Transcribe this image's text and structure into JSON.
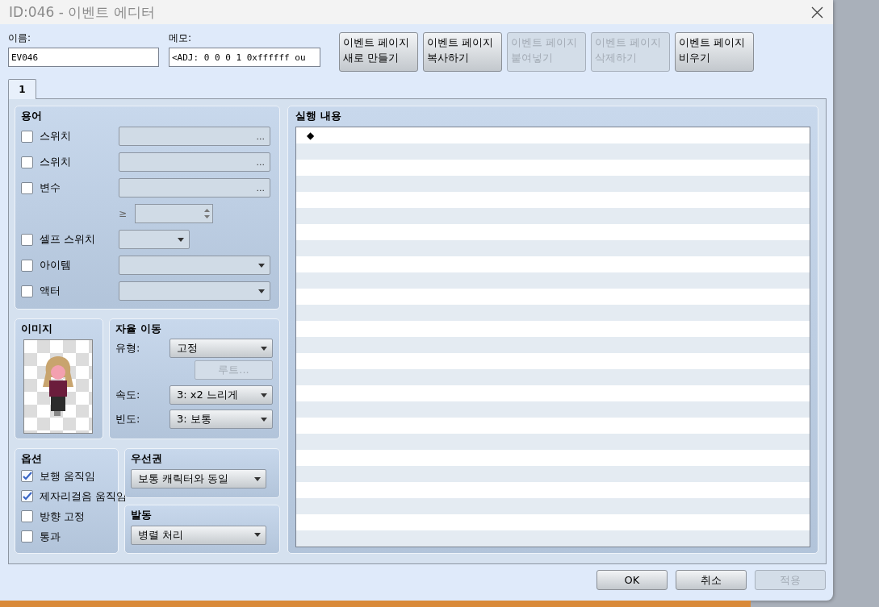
{
  "window": {
    "title": "ID:046 - 이벤트 에디터"
  },
  "name_field": {
    "label": "이름:",
    "value": "EV046"
  },
  "memo_field": {
    "label": "메모:",
    "value": "<ADJ: 0 0 0 1 0xffffff ou"
  },
  "page_buttons": [
    {
      "lines": [
        "이벤트 페이지",
        "새로 만들기"
      ],
      "disabled": false
    },
    {
      "lines": [
        "이벤트 페이지",
        "복사하기"
      ],
      "disabled": false
    },
    {
      "lines": [
        "이벤트 페이지",
        "붙여넣기"
      ],
      "disabled": true
    },
    {
      "lines": [
        "이벤트 페이지",
        "삭제하기"
      ],
      "disabled": true
    },
    {
      "lines": [
        "이벤트 페이지",
        "비우기"
      ],
      "disabled": false
    }
  ],
  "tabs": [
    {
      "label": "1",
      "selected": true
    }
  ],
  "conditions": {
    "title": "용어",
    "rows": [
      {
        "kind": "picker",
        "label": "스위치",
        "checked": false,
        "button": "..."
      },
      {
        "kind": "picker",
        "label": "스위치",
        "checked": false,
        "button": "..."
      },
      {
        "kind": "picker",
        "label": "변수",
        "checked": false,
        "button": "..."
      },
      {
        "kind": "spin",
        "symbol": "≥"
      },
      {
        "kind": "short_select",
        "label": "셀프 스위치",
        "checked": false
      },
      {
        "kind": "select",
        "label": "아이템",
        "checked": false
      },
      {
        "kind": "select",
        "label": "액터",
        "checked": false
      }
    ]
  },
  "image": {
    "title": "이미지"
  },
  "autonomous": {
    "title": "자율 이동",
    "type": {
      "label": "유형:",
      "value": "고정"
    },
    "route_button": {
      "label": "루트...",
      "disabled": true
    },
    "speed": {
      "label": "속도:",
      "value": "3: x2 느리게"
    },
    "frequency": {
      "label": "빈도:",
      "value": "3: 보통"
    }
  },
  "options": {
    "title": "옵션",
    "items": [
      {
        "label": "보행 움직임",
        "checked": true
      },
      {
        "label": "제자리걸음 움직임",
        "checked": true
      },
      {
        "label": "방향 고정",
        "checked": false
      },
      {
        "label": "통과",
        "checked": false
      }
    ]
  },
  "priority": {
    "title": "우선권",
    "value": "보통 캐릭터와 동일"
  },
  "trigger": {
    "title": "발동",
    "value": "병렬 처리"
  },
  "contents": {
    "title": "실행 내용",
    "items": [
      {
        "marker": "◆"
      }
    ]
  },
  "footer_buttons": [
    {
      "label": "OK",
      "disabled": false
    },
    {
      "label": "취소",
      "disabled": false
    },
    {
      "label": "적용",
      "disabled": true
    }
  ]
}
